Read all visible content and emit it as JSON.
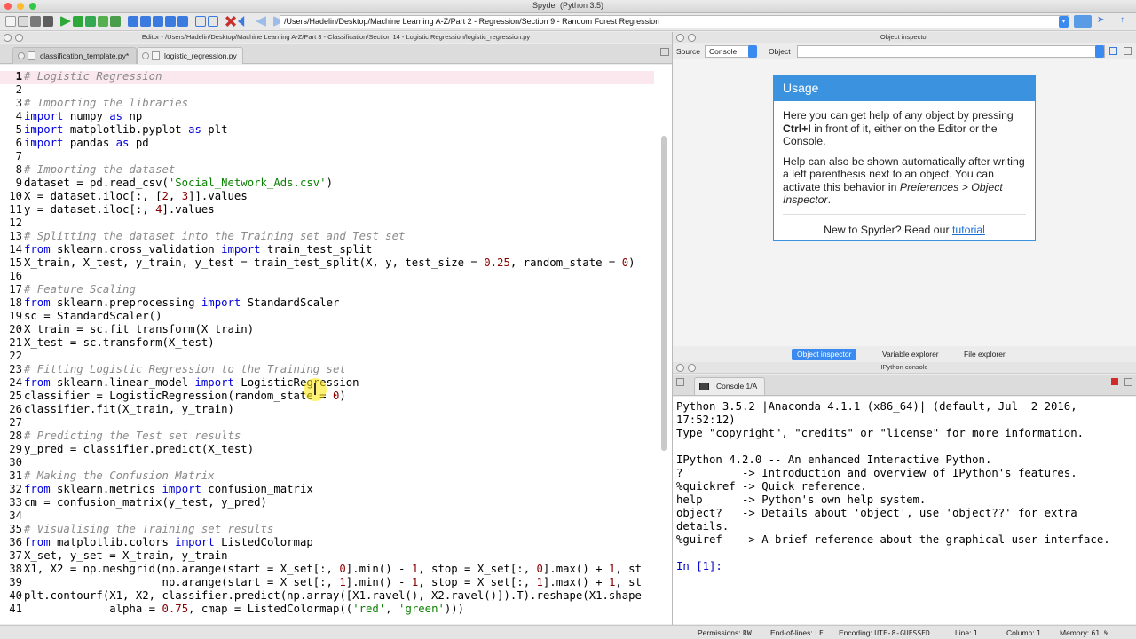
{
  "app": {
    "title": "Spyder (Python 3.5)"
  },
  "toolbar": {
    "path": "/Users/Hadelin/Desktop/Machine Learning A-Z/Part 2 - Regression/Section 9 - Random Forest Regression"
  },
  "editor": {
    "title": "Editor - /Users/Hadelin/Desktop/Machine Learning A-Z/Part 3 - Classification/Section 14 - Logistic Regression/logistic_regression.py",
    "tabs": [
      {
        "label": "classification_template.py*"
      },
      {
        "label": "logistic_regression.py"
      }
    ],
    "lines": [
      [
        {
          "t": "cm",
          "v": "# Logistic Regression"
        }
      ],
      [],
      [
        {
          "t": "cm",
          "v": "# Importing the libraries"
        }
      ],
      [
        {
          "t": "kw",
          "v": "import"
        },
        {
          "t": "p",
          "v": " numpy "
        },
        {
          "t": "kw",
          "v": "as"
        },
        {
          "t": "p",
          "v": " np"
        }
      ],
      [
        {
          "t": "kw",
          "v": "import"
        },
        {
          "t": "p",
          "v": " matplotlib.pyplot "
        },
        {
          "t": "kw",
          "v": "as"
        },
        {
          "t": "p",
          "v": " plt"
        }
      ],
      [
        {
          "t": "kw",
          "v": "import"
        },
        {
          "t": "p",
          "v": " pandas "
        },
        {
          "t": "kw",
          "v": "as"
        },
        {
          "t": "p",
          "v": " pd"
        }
      ],
      [],
      [
        {
          "t": "cm",
          "v": "# Importing the dataset"
        }
      ],
      [
        {
          "t": "p",
          "v": "dataset = pd.read_csv("
        },
        {
          "t": "str",
          "v": "'Social_Network_Ads.csv'"
        },
        {
          "t": "p",
          "v": ")"
        }
      ],
      [
        {
          "t": "p",
          "v": "X = dataset.iloc[:, ["
        },
        {
          "t": "num",
          "v": "2"
        },
        {
          "t": "p",
          "v": ", "
        },
        {
          "t": "num",
          "v": "3"
        },
        {
          "t": "p",
          "v": "]].values"
        }
      ],
      [
        {
          "t": "p",
          "v": "y = dataset.iloc[:, "
        },
        {
          "t": "num",
          "v": "4"
        },
        {
          "t": "p",
          "v": "].values"
        }
      ],
      [],
      [
        {
          "t": "cm",
          "v": "# Splitting the dataset into the Training set and Test set"
        }
      ],
      [
        {
          "t": "kw",
          "v": "from"
        },
        {
          "t": "p",
          "v": " sklearn.cross_validation "
        },
        {
          "t": "kw",
          "v": "import"
        },
        {
          "t": "p",
          "v": " train_test_split"
        }
      ],
      [
        {
          "t": "p",
          "v": "X_train, X_test, y_train, y_test = train_test_split(X, y, test_size = "
        },
        {
          "t": "num",
          "v": "0.25"
        },
        {
          "t": "p",
          "v": ", random_state = "
        },
        {
          "t": "num",
          "v": "0"
        },
        {
          "t": "p",
          "v": ")"
        }
      ],
      [],
      [
        {
          "t": "cm",
          "v": "# Feature Scaling"
        }
      ],
      [
        {
          "t": "kw",
          "v": "from"
        },
        {
          "t": "p",
          "v": " sklearn.preprocessing "
        },
        {
          "t": "kw",
          "v": "import"
        },
        {
          "t": "p",
          "v": " StandardScaler"
        }
      ],
      [
        {
          "t": "p",
          "v": "sc = StandardScaler()"
        }
      ],
      [
        {
          "t": "p",
          "v": "X_train = sc.fit_transform(X_train)"
        }
      ],
      [
        {
          "t": "p",
          "v": "X_test = sc.transform(X_test)"
        }
      ],
      [],
      [
        {
          "t": "cm",
          "v": "# Fitting Logistic Regression to the Training set"
        }
      ],
      [
        {
          "t": "kw",
          "v": "from"
        },
        {
          "t": "p",
          "v": " sklearn.linear_model "
        },
        {
          "t": "kw",
          "v": "import"
        },
        {
          "t": "p",
          "v": " LogisticRegression"
        }
      ],
      [
        {
          "t": "p",
          "v": "classifier = LogisticRegression(random_state = "
        },
        {
          "t": "num",
          "v": "0"
        },
        {
          "t": "p",
          "v": ")"
        }
      ],
      [
        {
          "t": "p",
          "v": "classifier.fit(X_train, y_train)"
        }
      ],
      [],
      [
        {
          "t": "cm",
          "v": "# Predicting the Test set results"
        }
      ],
      [
        {
          "t": "p",
          "v": "y_pred = classifier.predict(X_test)"
        }
      ],
      [],
      [
        {
          "t": "cm",
          "v": "# Making the Confusion Matrix"
        }
      ],
      [
        {
          "t": "kw",
          "v": "from"
        },
        {
          "t": "p",
          "v": " sklearn.metrics "
        },
        {
          "t": "kw",
          "v": "import"
        },
        {
          "t": "p",
          "v": " confusion_matrix"
        }
      ],
      [
        {
          "t": "p",
          "v": "cm = confusion_matrix(y_test, y_pred)"
        }
      ],
      [],
      [
        {
          "t": "cm",
          "v": "# Visualising the Training set results"
        }
      ],
      [
        {
          "t": "kw",
          "v": "from"
        },
        {
          "t": "p",
          "v": " matplotlib.colors "
        },
        {
          "t": "kw",
          "v": "import"
        },
        {
          "t": "p",
          "v": " ListedColormap"
        }
      ],
      [
        {
          "t": "p",
          "v": "X_set, y_set = X_train, y_train"
        }
      ],
      [
        {
          "t": "p",
          "v": "X1, X2 = np.meshgrid(np.arange(start = X_set[:, "
        },
        {
          "t": "num",
          "v": "0"
        },
        {
          "t": "p",
          "v": "].min() - "
        },
        {
          "t": "num",
          "v": "1"
        },
        {
          "t": "p",
          "v": ", stop = X_set[:, "
        },
        {
          "t": "num",
          "v": "0"
        },
        {
          "t": "p",
          "v": "].max() + "
        },
        {
          "t": "num",
          "v": "1"
        },
        {
          "t": "p",
          "v": ", st"
        }
      ],
      [
        {
          "t": "p",
          "v": "                     np.arange(start = X_set[:, "
        },
        {
          "t": "num",
          "v": "1"
        },
        {
          "t": "p",
          "v": "].min() - "
        },
        {
          "t": "num",
          "v": "1"
        },
        {
          "t": "p",
          "v": ", stop = X_set[:, "
        },
        {
          "t": "num",
          "v": "1"
        },
        {
          "t": "p",
          "v": "].max() + "
        },
        {
          "t": "num",
          "v": "1"
        },
        {
          "t": "p",
          "v": ", st"
        }
      ],
      [
        {
          "t": "p",
          "v": "plt.contourf(X1, X2, classifier.predict(np.array([X1.ravel(), X2.ravel()]).T).reshape(X1.shape"
        }
      ],
      [
        {
          "t": "p",
          "v": "             alpha = "
        },
        {
          "t": "num",
          "v": "0.75"
        },
        {
          "t": "p",
          "v": ", cmap = ListedColormap(("
        },
        {
          "t": "str",
          "v": "'red'"
        },
        {
          "t": "p",
          "v": ", "
        },
        {
          "t": "str",
          "v": "'green'"
        },
        {
          "t": "p",
          "v": ")))"
        }
      ]
    ]
  },
  "object_inspector": {
    "title": "Object inspector",
    "source_label": "Source",
    "source_value": "Console",
    "object_label": "Object",
    "usage_title": "Usage",
    "p1_a": "Here you can get help of any object by pressing ",
    "p1_b": "Ctrl+I",
    "p1_c": " in front of it, either on the Editor or the Console.",
    "p2_a": "Help can also be shown automatically after writing a left parenthesis next to an object. You can activate this behavior in ",
    "p2_b": "Preferences > Object Inspector",
    "p2_c": ".",
    "foot_text": "New to Spyder? Read our ",
    "foot_link": "tutorial"
  },
  "pane_tabs": [
    "Object inspector",
    "Variable explorer",
    "File explorer"
  ],
  "ipython": {
    "title": "IPython console",
    "tab": "Console 1/A",
    "lines": [
      "Python 3.5.2 |Anaconda 4.1.1 (x86_64)| (default, Jul  2 2016,",
      "17:52:12)",
      "Type \"copyright\", \"credits\" or \"license\" for more information.",
      "",
      "IPython 4.2.0 -- An enhanced Interactive Python.",
      "?         -> Introduction and overview of IPython's features.",
      "%quickref -> Quick reference.",
      "help      -> Python's own help system.",
      "object?   -> Details about 'object', use 'object??' for extra",
      "details.",
      "%guiref   -> A brief reference about the graphical user interface.",
      ""
    ],
    "prompt": "In [1]:"
  },
  "status": {
    "permissions_label": "Permissions:",
    "permissions_value": "RW",
    "eol_label": "End-of-lines:",
    "eol_value": "LF",
    "encoding_label": "Encoding:",
    "encoding_value": "UTF-8-GUESSED",
    "line_label": "Line:",
    "line_value": "1",
    "column_label": "Column:",
    "column_value": "1",
    "memory_label": "Memory:",
    "memory_value": "61 %"
  },
  "colors": {
    "accent": "#3b8af0",
    "keyword": "#0000e0",
    "comment": "#8a8a8a",
    "string": "#0a8000",
    "number": "#8a0000"
  }
}
